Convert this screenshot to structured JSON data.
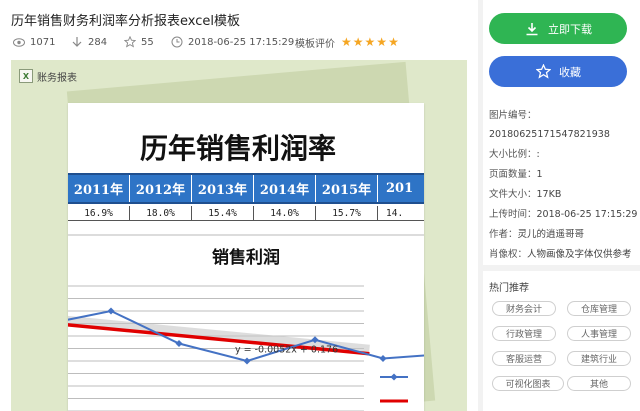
{
  "header": {
    "title": "历年销售财务利润率分析报表excel模板",
    "views": "1071",
    "downloads": "284",
    "favorites": "55",
    "date": "2018-06-25 17:15:29",
    "rating_label": "模板评价",
    "rating": 5
  },
  "preview": {
    "doc_label": "账务报表",
    "sheet_title": "历年销售利润率",
    "table": {
      "years": [
        "2011年",
        "2012年",
        "2013年",
        "2014年",
        "2015年",
        "201"
      ],
      "rates": [
        "16.9%",
        "18.0%",
        "15.4%",
        "14.0%",
        "15.7%",
        "14."
      ]
    }
  },
  "chart_data": {
    "type": "line",
    "title": "销售利润",
    "x": [
      1,
      2,
      3,
      4,
      5,
      6,
      7
    ],
    "series": [
      {
        "name": "",
        "values": [
          0.169,
          0.18,
          0.154,
          0.14,
          0.157,
          0.142,
          0.146
        ]
      }
    ],
    "trendline": {
      "equation": "y = -0.0052x + 0.176",
      "slope": -0.0052,
      "intercept": 0.176
    },
    "ylim": [
      0.1,
      0.2
    ],
    "grid": true,
    "colors": {
      "series": "#4472c4",
      "trendline": "#e00000"
    }
  },
  "sidebar": {
    "download_label": "立即下载",
    "favorite_label": "收藏",
    "info": {
      "id_label": "图片编号：",
      "id_value": "20180625171547821938",
      "scale_label": "大小比例：",
      "scale_value": ":",
      "pages_label": "页面数量：",
      "pages_value": "1",
      "size_label": "文件大小：",
      "size_value": "17KB",
      "upload_label": "上传时间：",
      "upload_value": "2018-06-25 17:15:29",
      "author_label": "作者：",
      "author_value": "灵儿的逍遥哥哥",
      "rights_label": "肖像权：",
      "rights_value": "人物画像及字体仅供参考"
    },
    "hot": {
      "title": "热门推荐",
      "tags": [
        "财务会计",
        "仓库管理",
        "行政管理",
        "人事管理",
        "客服运营",
        "建筑行业",
        "可视化图表",
        "其他"
      ]
    }
  },
  "colors": {
    "download": "#2fb553",
    "favorite": "#3a6fd8",
    "star": "#f5a623",
    "table_header": "#2e74c6",
    "preview_bg": "#dfe8ca"
  }
}
